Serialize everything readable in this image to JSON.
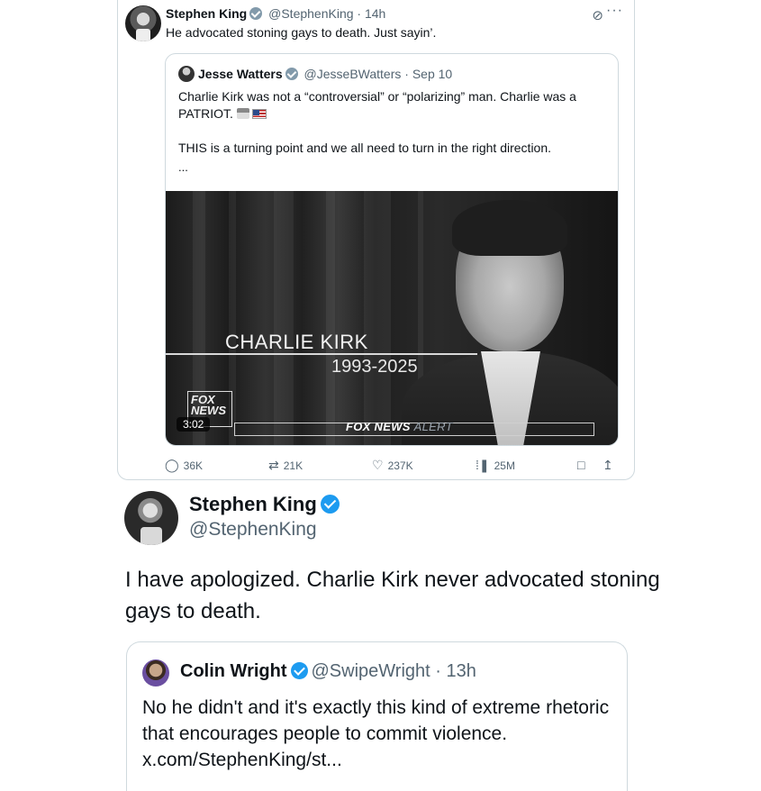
{
  "top_tweet": {
    "name": "Stephen King",
    "handle": "@StephenKing",
    "time": "14h",
    "text": "He advocated stoning gays to death. Just sayin’.",
    "quoted": {
      "name": "Jesse Watters",
      "handle": "@JesseBWatters",
      "date": "Sep 10",
      "line1": "Charlie Kirk was not a “controversial” or “polarizing” man. Charlie was a PATRIOT.",
      "line2": "THIS is a turning point and we all need to turn in the right direction.",
      "ellipsis": "...",
      "media": {
        "name_caption": "CHARLIE KIRK",
        "years": "1993-2025",
        "logo": "FOX NEWS",
        "alert_main": "FOX NEWS",
        "alert_sub": "ALERT",
        "duration": "3:02"
      }
    },
    "stats": {
      "replies": "36K",
      "reposts": "21K",
      "likes": "237K",
      "views": "25M"
    },
    "icons": {
      "verified": "verified-badge-icon",
      "grok": "grok-icon",
      "more": "more-icon",
      "reply": "reply-icon",
      "repost": "repost-icon",
      "like": "heart-icon",
      "views": "views-chart-icon",
      "bookmark": "bookmark-icon",
      "share": "share-icon"
    }
  },
  "main_tweet": {
    "name": "Stephen King",
    "handle": "@StephenKing",
    "text": "I have apologized. Charlie Kirk never advocated stoning gays to death.",
    "quoted": {
      "name": "Colin Wright",
      "handle": "@SwipeWright",
      "time": "13h",
      "text": "No he didn't and it's exactly this kind of extreme rhetoric that encourages people to commit violence. x.com/StephenKing/st..."
    }
  },
  "colors": {
    "verified_blue": "#1d9bf0",
    "verified_gray": "#829aab",
    "secondary_text": "#536471",
    "border": "#cfd9de"
  }
}
